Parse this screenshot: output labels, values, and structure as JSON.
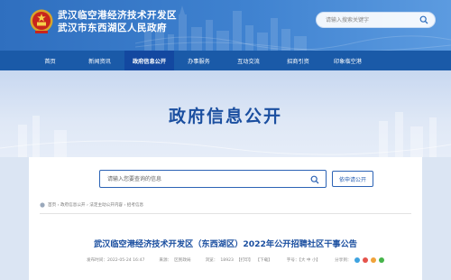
{
  "header": {
    "title_line1": "武汉临空港经济技术开发区",
    "title_line2": "武汉市东西湖区人民政府",
    "search_placeholder": "请输入搜索关键字"
  },
  "nav": {
    "items": [
      "首页",
      "新闻资讯",
      "政府信息公开",
      "办事服务",
      "互动交流",
      "招商引资",
      "印象临空港"
    ],
    "active_index": 2
  },
  "banner": {
    "title": "政府信息公开"
  },
  "content": {
    "search_placeholder": "请输入您要查询的信息",
    "apply_button": "依申请公开",
    "breadcrumb": "首页 › 政府信息公开 › 法定主动公开内容 › 招考信息",
    "article_title": "武汉临空港经济技术开发区（东西湖区）2022年公开招聘社区干事公告",
    "meta": {
      "date": "发布时间：2022-05-24 16:47",
      "source": "来源：",
      "author": "区民政局",
      "views_label": "浏览：",
      "views": "18923",
      "print": "【打印】",
      "download": "【下载】",
      "font_size": "字号：【大 中 小】",
      "share": "分享到："
    }
  },
  "colors": {
    "header_blue": "#2f6fbf",
    "nav_blue": "#1a5aa8",
    "title_blue": "#1b4fa0",
    "share_colors": [
      "#3ea3e0",
      "#e5534b",
      "#f0a33a",
      "#46b44a"
    ]
  }
}
